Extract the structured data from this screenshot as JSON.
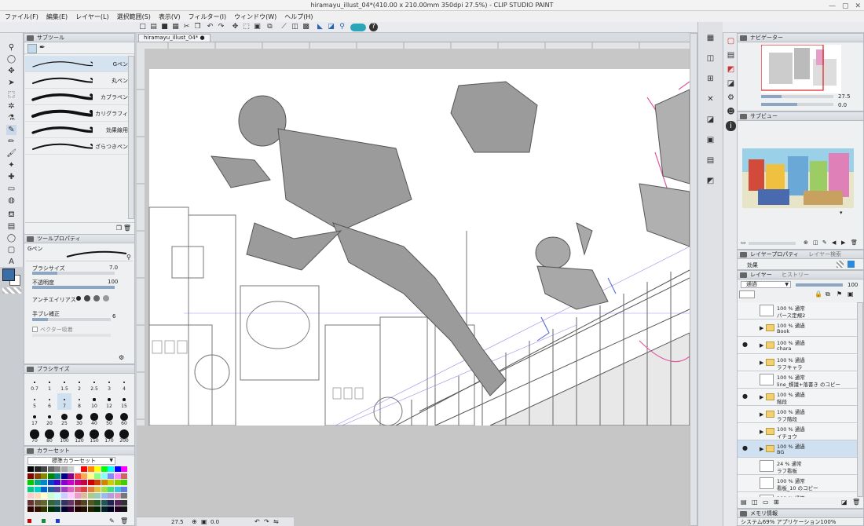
{
  "window": {
    "title": "hiramayu_illust_04*(410.00 x 210.00mm 350dpi 27.5%) - CLIP STUDIO PAINT"
  },
  "menu": [
    "ファイル(F)",
    "編集(E)",
    "レイヤー(L)",
    "選択範囲(S)",
    "表示(V)",
    "フィルター(I)",
    "ウィンドウ(W)",
    "ヘルプ(H)"
  ],
  "document_tab": {
    "label": "hiramayu_illust_04*"
  },
  "subtool_panel": {
    "title": "サブツール",
    "brushes": [
      "Gペン",
      "丸ペン",
      "カブラペン",
      "カリグラフィ",
      "効果線用",
      "ざらつきペン"
    ],
    "selected": "Gペン"
  },
  "tool_property": {
    "title": "ツールプロパティ",
    "tool_name": "Gペン",
    "brush_size_label": "ブラシサイズ",
    "brush_size": "7.0",
    "opacity_label": "不透明度",
    "opacity": "100",
    "antialias_label": "アンチエイリアス",
    "stabilization_label": "手ブレ補正",
    "stabilization": "6",
    "vector_label": "ベクター吸着"
  },
  "brush_size_panel": {
    "title": "ブラシサイズ",
    "sizes": [
      "0.7",
      "1",
      "1.5",
      "2",
      "2.5",
      "3",
      "4",
      "5",
      "6",
      "7",
      "8",
      "10",
      "12",
      "15",
      "17",
      "20",
      "25",
      "30",
      "40",
      "50",
      "60",
      "70",
      "80",
      "100",
      "120",
      "150",
      "170",
      "200"
    ]
  },
  "color_set": {
    "title": "カラーセット",
    "set_name": "標準カラーセット"
  },
  "navigator": {
    "title": "ナビゲーター",
    "zoom": "27.5",
    "rotation": "0.0"
  },
  "subview": {
    "title": "サブビュー"
  },
  "layer_property": {
    "tab1": "レイヤープロパティ",
    "tab2": "レイヤー検索",
    "effect_label": "効果"
  },
  "layer_panel": {
    "tab1": "レイヤー",
    "tab2": "ヒストリー",
    "blend_mode": "通過",
    "opacity": "100",
    "layers": [
      {
        "l1": "100 % 通常",
        "l2": "パース定規2",
        "kind": "ruler",
        "visible": false
      },
      {
        "l1": "100 % 通過",
        "l2": "Book",
        "kind": "folder",
        "visible": false
      },
      {
        "l1": "100 % 通過",
        "l2": "chara",
        "kind": "folder",
        "visible": true
      },
      {
        "l1": "100 % 通過",
        "l2": "ラフキャラ",
        "kind": "folder",
        "visible": false
      },
      {
        "l1": "100 % 通常",
        "l2": "line_標識+落書き のコピー",
        "kind": "raster",
        "visible": false
      },
      {
        "l1": "100 % 通過",
        "l2": "階段",
        "kind": "folder",
        "visible": true
      },
      {
        "l1": "100 % 通過",
        "l2": "ラフ階段",
        "kind": "folder",
        "visible": false
      },
      {
        "l1": "100 % 通過",
        "l2": "イチョウ",
        "kind": "folder",
        "visible": false
      },
      {
        "l1": "100 % 通過",
        "l2": "BG",
        "kind": "folder",
        "visible": true,
        "selected": true
      },
      {
        "l1": "24 % 通常",
        "l2": "ラフ看板",
        "kind": "raster",
        "visible": false
      },
      {
        "l1": "100 % 通常",
        "l2": "看板_10 のコピー",
        "kind": "raster",
        "visible": false
      },
      {
        "l1": "100 % 通常",
        "l2": "",
        "kind": "raster",
        "visible": false
      }
    ]
  },
  "memory_panel": {
    "title": "メモリ情報",
    "text": "システム69%  アプリケーション100%"
  },
  "status_bar": {
    "zoom": "27.5",
    "angle": "0.0"
  },
  "colors": {
    "accent_blue": "#3d7ecb",
    "main_color": "#3a6ea8",
    "sub_color": "#ffffff"
  }
}
